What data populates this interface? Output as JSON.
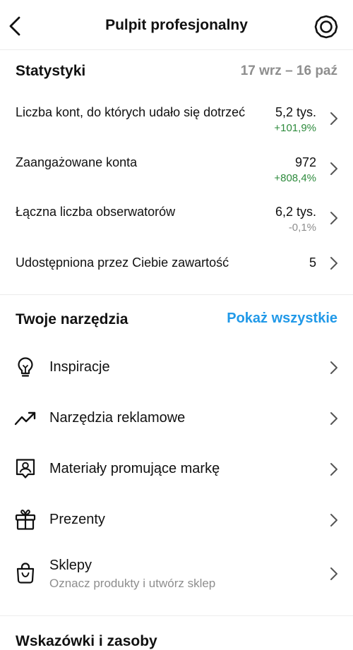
{
  "header": {
    "title": "Pulpit profesjonalny",
    "back_icon": "chevron-left-icon",
    "settings_icon": "gear-icon"
  },
  "stats": {
    "title": "Statystyki",
    "date_range": "17 wrz – 16 paź",
    "rows": [
      {
        "label": "Liczba kont, do których udało się dotrzeć",
        "value": "5,2 tys.",
        "change": "+101,9%",
        "change_color": "#2e8b3d"
      },
      {
        "label": "Zaangażowane konta",
        "value": "972",
        "change": "+808,4%",
        "change_color": "#2e8b3d"
      },
      {
        "label": "Łączna liczba obserwatorów",
        "value": "6,2 tys.",
        "change": "-0,1%",
        "change_color": "#8e8e8e"
      },
      {
        "label": "Udostępniona przez Ciebie zawartość",
        "value": "5"
      }
    ]
  },
  "tools": {
    "title": "Twoje narzędzia",
    "show_all": "Pokaż wszystkie",
    "items": [
      {
        "label": "Inspiracje",
        "icon": "lightbulb-icon"
      },
      {
        "label": "Narzędzia reklamowe",
        "icon": "trending-up-icon"
      },
      {
        "label": "Materiały promujące markę",
        "icon": "brand-badge-icon"
      },
      {
        "label": "Prezenty",
        "icon": "gift-icon"
      },
      {
        "label": "Sklepy",
        "sublabel": "Oznacz produkty i utwórz sklep",
        "icon": "shopping-bag-icon"
      }
    ]
  },
  "tips": {
    "title": "Wskazówki i zasoby"
  },
  "colors": {
    "accent": "#2199e8",
    "positive": "#2e8b3d",
    "muted": "#8e8e8e"
  }
}
